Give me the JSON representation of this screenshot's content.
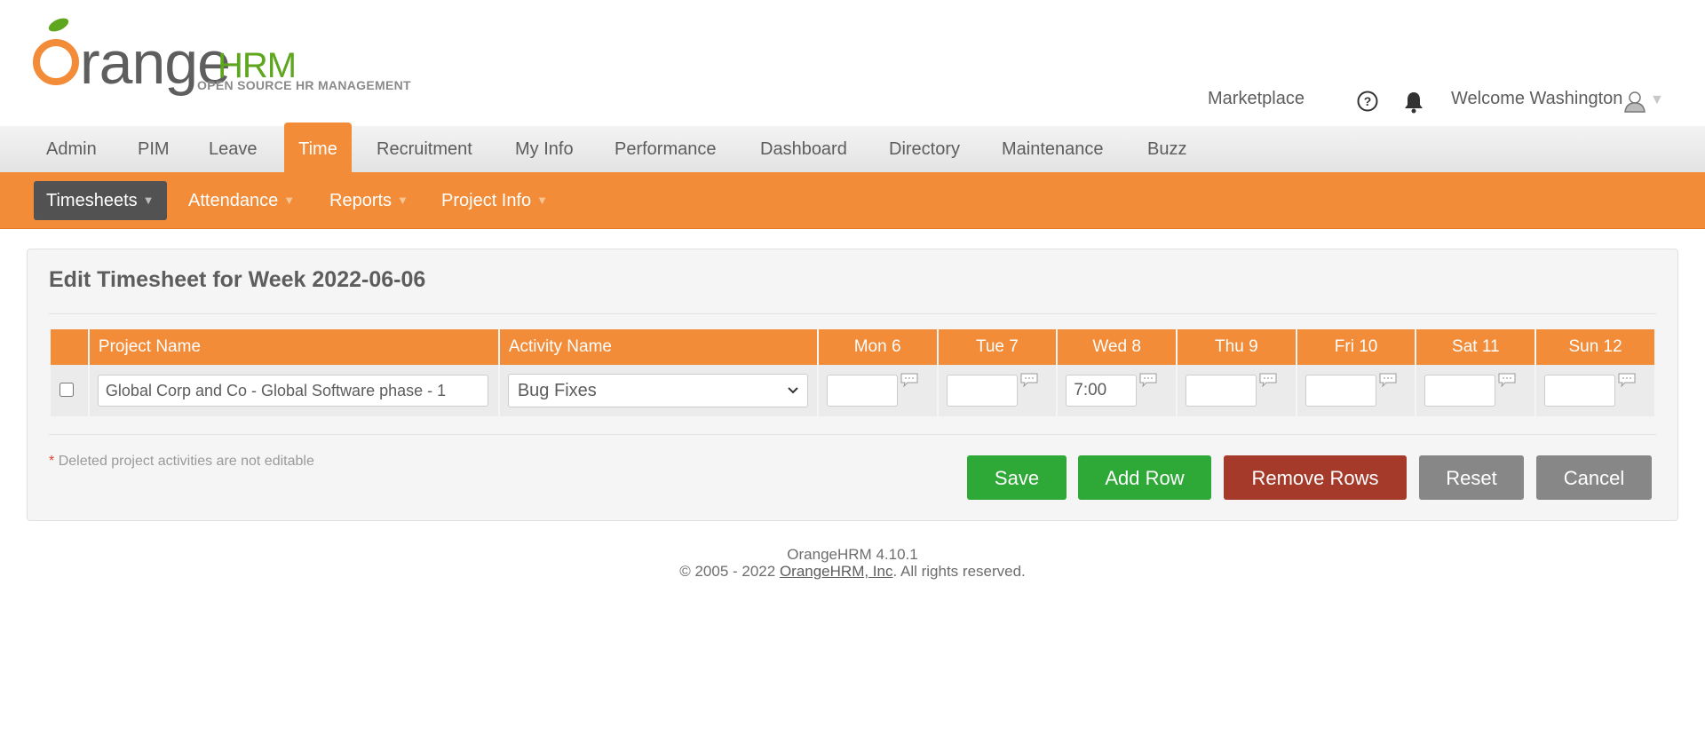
{
  "logo": {
    "word": "range",
    "hrm": "HRM",
    "tagline": "OPEN SOURCE HR MANAGEMENT",
    "colors": {
      "orange": "#f28c38",
      "green": "#5ea61e"
    }
  },
  "header": {
    "marketplace": "Marketplace",
    "welcome": "Welcome Washington"
  },
  "mainnav": [
    "Admin",
    "PIM",
    "Leave",
    "Time",
    "Recruitment",
    "My Info",
    "Performance",
    "Dashboard",
    "Directory",
    "Maintenance",
    "Buzz"
  ],
  "mainnav_active": "Time",
  "subnav": [
    "Timesheets",
    "Attendance",
    "Reports",
    "Project Info"
  ],
  "subnav_active": "Timesheets",
  "panel": {
    "title": "Edit Timesheet for Week 2022-06-06",
    "columns": {
      "project": "Project Name",
      "activity": "Activity Name",
      "days": [
        "Mon 6",
        "Tue 7",
        "Wed 8",
        "Thu 9",
        "Fri 10",
        "Sat 11",
        "Sun 12"
      ]
    },
    "row": {
      "project_value": "Global Corp and Co - Global Software phase - 1",
      "activity_value": "Bug Fixes",
      "hours": [
        "",
        "",
        "7:00",
        "",
        "",
        "",
        ""
      ]
    },
    "note_star": "*",
    "note": "Deleted project activities are not editable",
    "buttons": {
      "save": "Save",
      "add_row": "Add Row",
      "remove_rows": "Remove Rows",
      "reset": "Reset",
      "cancel": "Cancel"
    }
  },
  "footer": {
    "version": "OrangeHRM 4.10.1",
    "copyright_pre": "© 2005 - 2022 ",
    "company": "OrangeHRM, Inc",
    "copyright_post": ". All rights reserved."
  }
}
